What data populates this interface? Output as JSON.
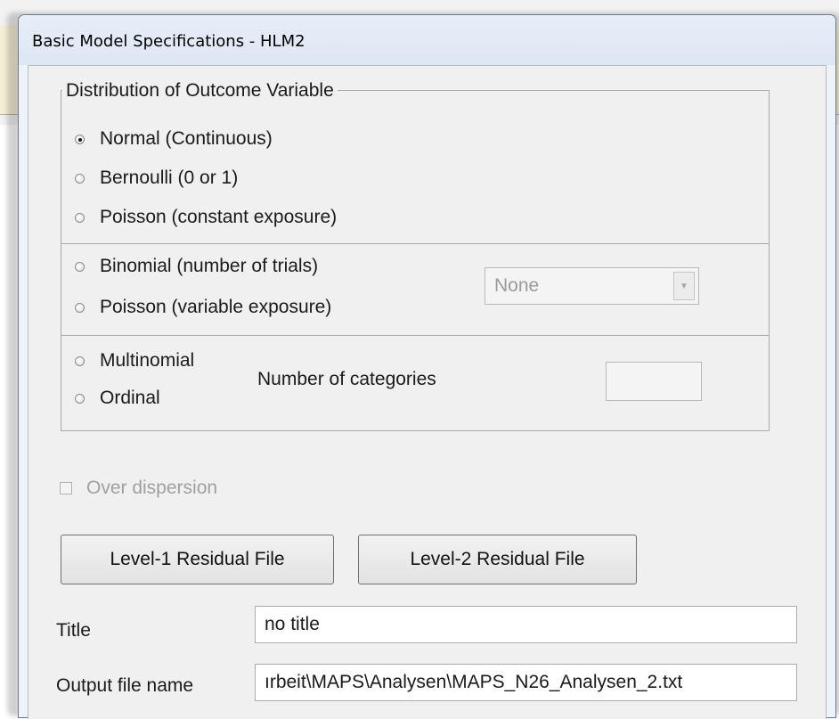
{
  "dialog": {
    "title": "Basic Model Specifications - HLM2"
  },
  "distribution": {
    "group_label": "Distribution of Outcome Variable",
    "options": [
      {
        "label": "Normal (Continuous)",
        "checked": true
      },
      {
        "label": "Bernoulli  (0 or 1)",
        "checked": false
      },
      {
        "label": "Poisson (constant exposure)",
        "checked": false
      },
      {
        "label": "Binomial (number of trials)",
        "checked": false
      },
      {
        "label": "Poisson (variable exposure)",
        "checked": false
      },
      {
        "label": "Multinomial",
        "checked": false
      },
      {
        "label": "Ordinal",
        "checked": false
      }
    ],
    "trials_select": {
      "value": "None",
      "enabled": false
    },
    "categories_label": "Number of categories",
    "categories_value": ""
  },
  "over_dispersion": {
    "label": "Over dispersion",
    "checked": false,
    "enabled": false
  },
  "buttons": {
    "level1": "Level-1 Residual File",
    "level2": "Level-2 Residual File"
  },
  "fields": {
    "title_label": "Title",
    "title_value": "no title",
    "output_label": "Output file name",
    "output_value": "ırbeit\\MAPS\\Analysen\\MAPS_N26_Analysen_2.txt"
  }
}
